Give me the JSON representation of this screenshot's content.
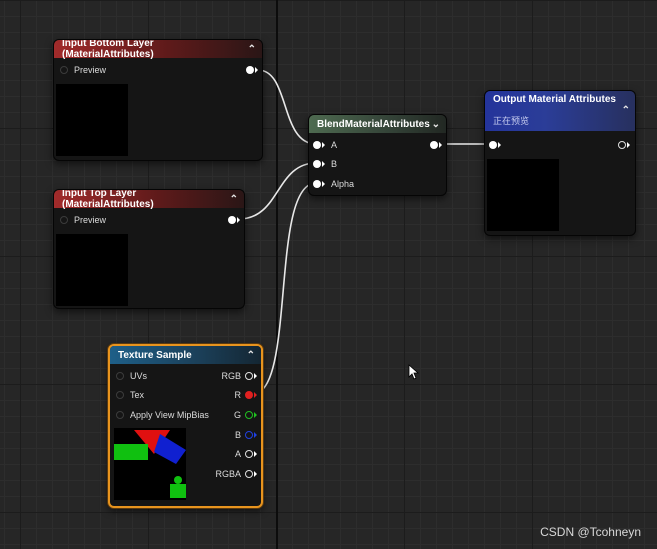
{
  "nodes": {
    "input_bottom": {
      "title": "Input Bottom Layer (MaterialAttributes)",
      "pin_preview": "Preview"
    },
    "input_top": {
      "title": "Input Top Layer (MaterialAttributes)",
      "pin_preview": "Preview"
    },
    "blend": {
      "title": "BlendMaterialAttributes",
      "pin_a": "A",
      "pin_b": "B",
      "pin_alpha": "Alpha"
    },
    "output": {
      "title": "Output Material Attributes",
      "subtitle": "正在预览"
    },
    "texture": {
      "title": "Texture Sample",
      "inputs": [
        "UVs",
        "Tex",
        "Apply View MipBias"
      ],
      "outputs": [
        "RGB",
        "R",
        "G",
        "B",
        "A",
        "RGBA"
      ]
    }
  },
  "colors": {
    "pin_r": "#e02020",
    "pin_g": "#20c020",
    "pin_b": "#2040e0",
    "selection": "#e8941e"
  },
  "icons": {
    "collapse": "chevron-up-icon",
    "expand": "chevron-down-icon",
    "cursor": "mouse-cursor-icon"
  },
  "watermark": "CSDN @Tcohneyn"
}
